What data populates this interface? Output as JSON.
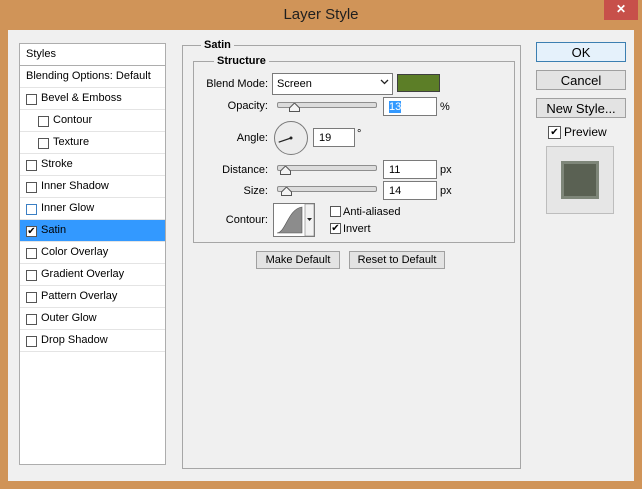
{
  "window": {
    "title": "Layer Style",
    "close_label": "✕"
  },
  "sidebar": {
    "header": "Styles",
    "items": [
      {
        "label": "Blending Options: Default",
        "checkbox": false,
        "checked": false,
        "indent": 0
      },
      {
        "label": "Bevel & Emboss",
        "checkbox": true,
        "checked": false,
        "indent": 0
      },
      {
        "label": "Contour",
        "checkbox": true,
        "checked": false,
        "indent": 1
      },
      {
        "label": "Texture",
        "checkbox": true,
        "checked": false,
        "indent": 1
      },
      {
        "label": "Stroke",
        "checkbox": true,
        "checked": false,
        "indent": 0
      },
      {
        "label": "Inner Shadow",
        "checkbox": true,
        "checked": false,
        "indent": 0
      },
      {
        "label": "Inner Glow",
        "checkbox": true,
        "checked": false,
        "indent": 0
      },
      {
        "label": "Satin",
        "checkbox": true,
        "checked": true,
        "indent": 0,
        "selected": true
      },
      {
        "label": "Color Overlay",
        "checkbox": true,
        "checked": false,
        "indent": 0
      },
      {
        "label": "Gradient Overlay",
        "checkbox": true,
        "checked": false,
        "indent": 0
      },
      {
        "label": "Pattern Overlay",
        "checkbox": true,
        "checked": false,
        "indent": 0
      },
      {
        "label": "Outer Glow",
        "checkbox": true,
        "checked": false,
        "indent": 0
      },
      {
        "label": "Drop Shadow",
        "checkbox": true,
        "checked": false,
        "indent": 0
      }
    ]
  },
  "satin": {
    "group_title": "Satin",
    "structure_title": "Structure",
    "blend_mode": {
      "label": "Blend Mode:",
      "value": "Screen",
      "color": "#5c7e27"
    },
    "opacity": {
      "label": "Opacity:",
      "value": "13",
      "unit": "%",
      "level": 0.13
    },
    "angle": {
      "label": "Angle:",
      "value": "19",
      "unit": "°"
    },
    "distance": {
      "label": "Distance:",
      "value": "11",
      "unit": "px",
      "level": 0.044
    },
    "size": {
      "label": "Size:",
      "value": "14",
      "unit": "px",
      "level": 0.056
    },
    "contour": {
      "label": "Contour:",
      "anti_aliased_label": "Anti-aliased",
      "anti_aliased": false,
      "invert_label": "Invert",
      "invert": true
    },
    "make_default_label": "Make Default",
    "reset_default_label": "Reset to Default"
  },
  "actions": {
    "ok_label": "OK",
    "cancel_label": "Cancel",
    "new_style_label": "New Style...",
    "preview_label": "Preview",
    "preview_checked": true
  }
}
